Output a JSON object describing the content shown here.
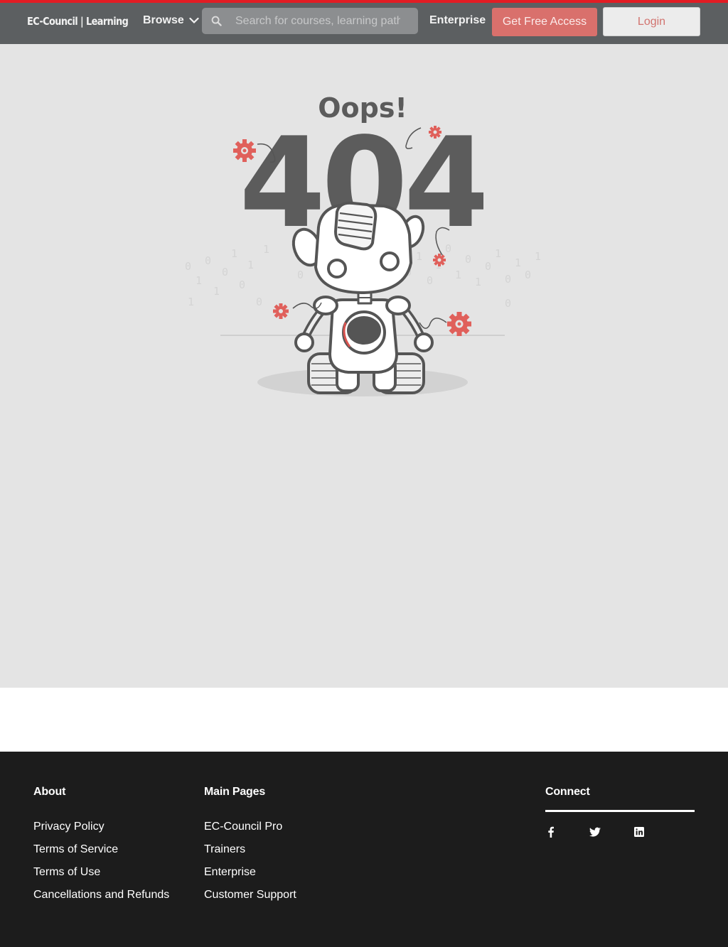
{
  "header": {
    "logo": "EC-Council | Learning",
    "browse_label": "Browse",
    "search_placeholder": "Search for courses, learning paths...",
    "enterprise_label": "Enterprise",
    "free_access_label": "Get Free Access",
    "login_label": "Login"
  },
  "error": {
    "title": "Oops!",
    "code": "404"
  },
  "footer": {
    "about": {
      "heading": "About",
      "links": [
        "Privacy Policy",
        "Terms of Service",
        "Terms of Use",
        "Cancellations and Refunds"
      ]
    },
    "main_pages": {
      "heading": "Main Pages",
      "links": [
        "EC-Council Pro",
        "Trainers",
        "Enterprise",
        "Customer Support"
      ]
    },
    "connect": {
      "heading": "Connect",
      "icons": [
        "facebook-icon",
        "twitter-icon",
        "linkedin-icon"
      ]
    }
  },
  "colors": {
    "top_accent": "#e21c23",
    "navbar": "#5c5f61",
    "primary_button": "#d9706c",
    "gear": "#e0605b",
    "footer_bg": "#1c1c1c"
  }
}
